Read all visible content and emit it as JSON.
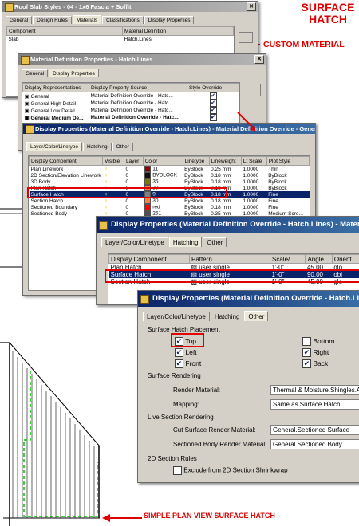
{
  "annotations": {
    "title_line1": "SURFACE",
    "title_line2": "HATCH",
    "custom_material": "CUSTOM MATERIAL",
    "plan_view": "SIMPLE PLAN VIEW SURFACE HATCH"
  },
  "win1": {
    "title": "Roof Slab Styles - 04 - 1x6 Fascia + Soffit",
    "tabs": [
      "General",
      "Design Rules",
      "Materials",
      "Classifications",
      "Display Properties"
    ],
    "headers": [
      "Component",
      "Material Definition"
    ],
    "row": [
      "Slab",
      "Hatch.Lines"
    ]
  },
  "win2": {
    "title": "Material Definition Properties - Hatch.Lines",
    "tabs": [
      "General",
      "Display Properties"
    ],
    "headers": [
      "Display Representations",
      "Display Property Source",
      "Style Override"
    ],
    "rows": [
      [
        "General",
        "Material Definition Override - Hatc..."
      ],
      [
        "General High Detail",
        "Material Definition Override - Hatc..."
      ],
      [
        "General Low Detail",
        "Material Definition Override - Hatc..."
      ],
      [
        "General Medium De...",
        "Material Definition Override - Hatc..."
      ]
    ]
  },
  "win3": {
    "title": "Display Properties (Material Definition Override - Hatch.Lines) - Material Definition Override - General Medi...",
    "tabs": [
      "Layer/Color/Linetype",
      "Hatching",
      "Other"
    ],
    "headers": [
      "Display Component",
      "Visible",
      "Layer",
      "Color",
      "Linetype",
      "Lineweight",
      "Lt Scale",
      "Plot Style"
    ],
    "rows": [
      [
        "Plan Linework",
        "0",
        "11",
        "ByBlock",
        "0.25 mm",
        "1.0000",
        "Thin"
      ],
      [
        "2D Section/Elevation Linework",
        "0",
        "BYBLOCK",
        "ByBlock",
        "0.18 mm",
        "1.0000",
        "ByBlock"
      ],
      [
        "3D Body",
        "0",
        "35",
        "ByBlock",
        "0.18 mm",
        "1.0000",
        "ByBlock"
      ],
      [
        "Plan Hatch",
        "0",
        "30",
        "ByBlock",
        "0.18 mm",
        "1.0000",
        "ByBlock"
      ],
      [
        "Surface Hatch",
        "0",
        "9",
        "ByBlock",
        "0.18 mm",
        "1.0000",
        "Fine"
      ],
      [
        "Section Hatch",
        "0",
        "30",
        "ByBlock",
        "0.18 mm",
        "1.0000",
        "Fine"
      ],
      [
        "Sectioned Boundary",
        "0",
        "red",
        "ByBlock",
        "0.18 mm",
        "1.0000",
        "Fine"
      ],
      [
        "Sectioned Body",
        "0",
        "251",
        "ByBlock",
        "0.35 mm",
        "1.0000",
        "Medium Scre..."
      ]
    ],
    "colors": [
      "#8b0000",
      "#101010",
      "#7a7a00",
      "#ff8040",
      "#7f7f7f",
      "#ff8040",
      "#ff0000",
      "#505050"
    ]
  },
  "win4": {
    "title": "Display Properties (Material Definition Override - Hatch.Lines) - Material D",
    "tabs": [
      "Layer/Color/Linetype",
      "Hatching",
      "Other"
    ],
    "headers": [
      "Display Component",
      "Pattern",
      "Scale/...",
      "Angle",
      "Orient"
    ],
    "rows": [
      [
        "Plan Hatch",
        "user single",
        "1'-0\"",
        "45.00",
        "glo"
      ],
      [
        "Surface Hatch",
        "user single",
        "1'-0\"",
        "90.00",
        "obj"
      ],
      [
        "Section Hatch",
        "user single",
        "1'-0\"",
        "45.00",
        "glo"
      ]
    ]
  },
  "win5": {
    "title": "Display Properties (Material Definition Override - Hatch.Lines",
    "tabs": [
      "Layer/Color/Linetype",
      "Hatching",
      "Other"
    ],
    "placement_label": "Surface Hatch Placement",
    "checks_left": [
      {
        "label": "Top",
        "checked": "✔"
      },
      {
        "label": "Left",
        "checked": "✔"
      },
      {
        "label": "Front",
        "checked": "✔"
      }
    ],
    "checks_right": [
      {
        "label": "Bottom",
        "checked": ""
      },
      {
        "label": "Right",
        "checked": "✔"
      },
      {
        "label": "Back",
        "checked": "✔"
      }
    ],
    "rendering_label": "Surface Rendering",
    "render_material_label": "Render Material:",
    "render_material_value": "Thermal & Moisture.Shingles.Asph",
    "mapping_label": "Mapping:",
    "mapping_value": "Same as Surface Hatch",
    "live_section_label": "Live Section Rendering",
    "cut_label": "Cut Surface Render Material:",
    "cut_value": "General.Sectioned Surface",
    "sectioned_label": "Sectioned Body Render Material:",
    "sectioned_value": "General.Sectioned Body",
    "rules_label": "2D Section Rules",
    "exclude_label": "Exclude from 2D Section Shrinkwrap"
  }
}
